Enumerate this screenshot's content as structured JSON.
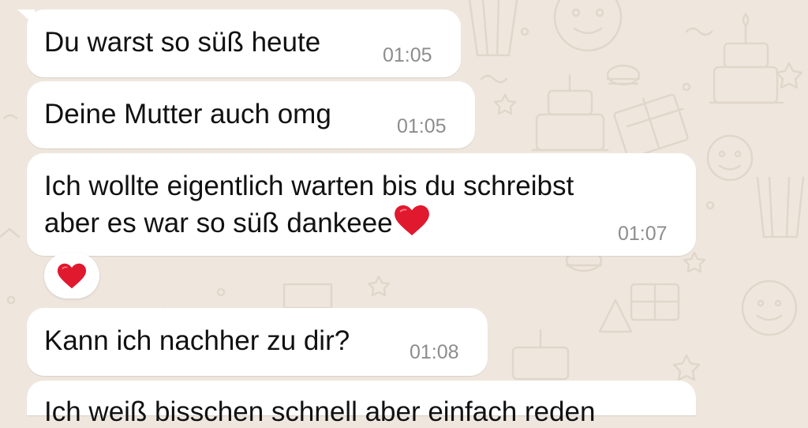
{
  "messages": [
    {
      "text": "Du warst so süß heute",
      "time": "01:05"
    },
    {
      "text": "Deine Mutter auch omg",
      "time": "01:05"
    },
    {
      "line1": "Ich wollte eigentlich warten bis du schreibst",
      "line2": "aber es war so süß dankeee",
      "emoji": "red-heart-icon",
      "time": "01:07",
      "reaction": "red-heart-icon"
    },
    {
      "text": "Kann ich nachher zu dir?",
      "time": "01:08"
    },
    {
      "text": "Ich weiß bisschen schnell aber einfach reden"
    }
  ],
  "colors": {
    "background": "#efe7de",
    "bubble": "#ffffff",
    "text": "#111111",
    "timestamp": "#8d8d8d",
    "heart": "#e0192e",
    "doodle": "#e2d8cd"
  }
}
